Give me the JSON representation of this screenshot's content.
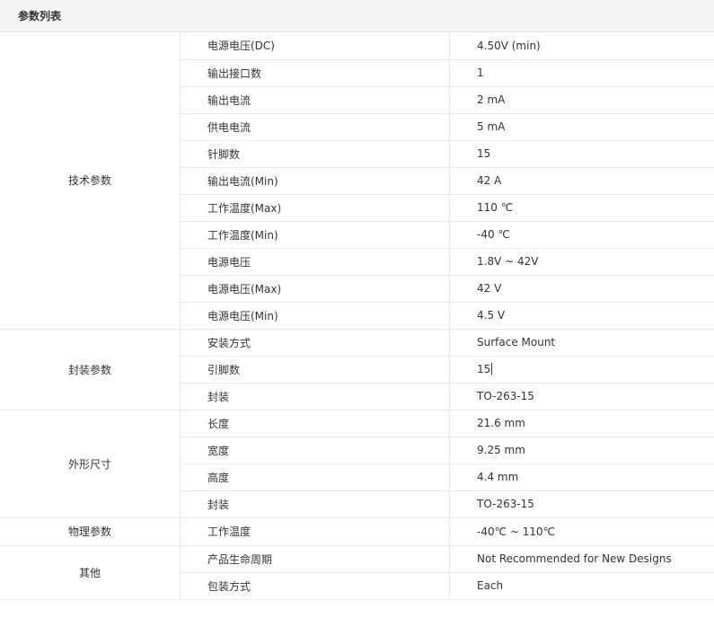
{
  "title": "参数列表",
  "groups": [
    {
      "name": "技术参数",
      "rows": [
        {
          "label": "电源电压(DC)",
          "value": "4.50V (min)"
        },
        {
          "label": "输出接口数",
          "value": "1"
        },
        {
          "label": "输出电流",
          "value": "2 mA"
        },
        {
          "label": "供电电流",
          "value": "5 mA"
        },
        {
          "label": "针脚数",
          "value": "15"
        },
        {
          "label": "输出电流(Min)",
          "value": "42 A"
        },
        {
          "label": "工作温度(Max)",
          "value": "110 ℃"
        },
        {
          "label": "工作温度(Min)",
          "value": "-40 ℃"
        },
        {
          "label": "电源电压",
          "value": "1.8V ~ 42V"
        },
        {
          "label": "电源电压(Max)",
          "value": "42 V"
        },
        {
          "label": "电源电压(Min)",
          "value": "4.5 V"
        }
      ]
    },
    {
      "name": "封装参数",
      "rows": [
        {
          "label": "安装方式",
          "value": "Surface Mount"
        },
        {
          "label": "引脚数",
          "value": "15"
        },
        {
          "label": "封装",
          "value": "TO-263-15"
        }
      ]
    },
    {
      "name": "外形尺寸",
      "rows": [
        {
          "label": "长度",
          "value": "21.6 mm"
        },
        {
          "label": "宽度",
          "value": "9.25 mm"
        },
        {
          "label": "高度",
          "value": "4.4 mm"
        },
        {
          "label": "封装",
          "value": "TO-263-15"
        }
      ]
    },
    {
      "name": "物理参数",
      "rows": [
        {
          "label": "工作温度",
          "value": "-40℃ ~ 110℃"
        }
      ]
    },
    {
      "name": "其他",
      "rows": [
        {
          "label": "产品生命周期",
          "value": "Not Recommended for New Designs"
        },
        {
          "label": "包装方式",
          "value": "Each"
        }
      ]
    }
  ]
}
